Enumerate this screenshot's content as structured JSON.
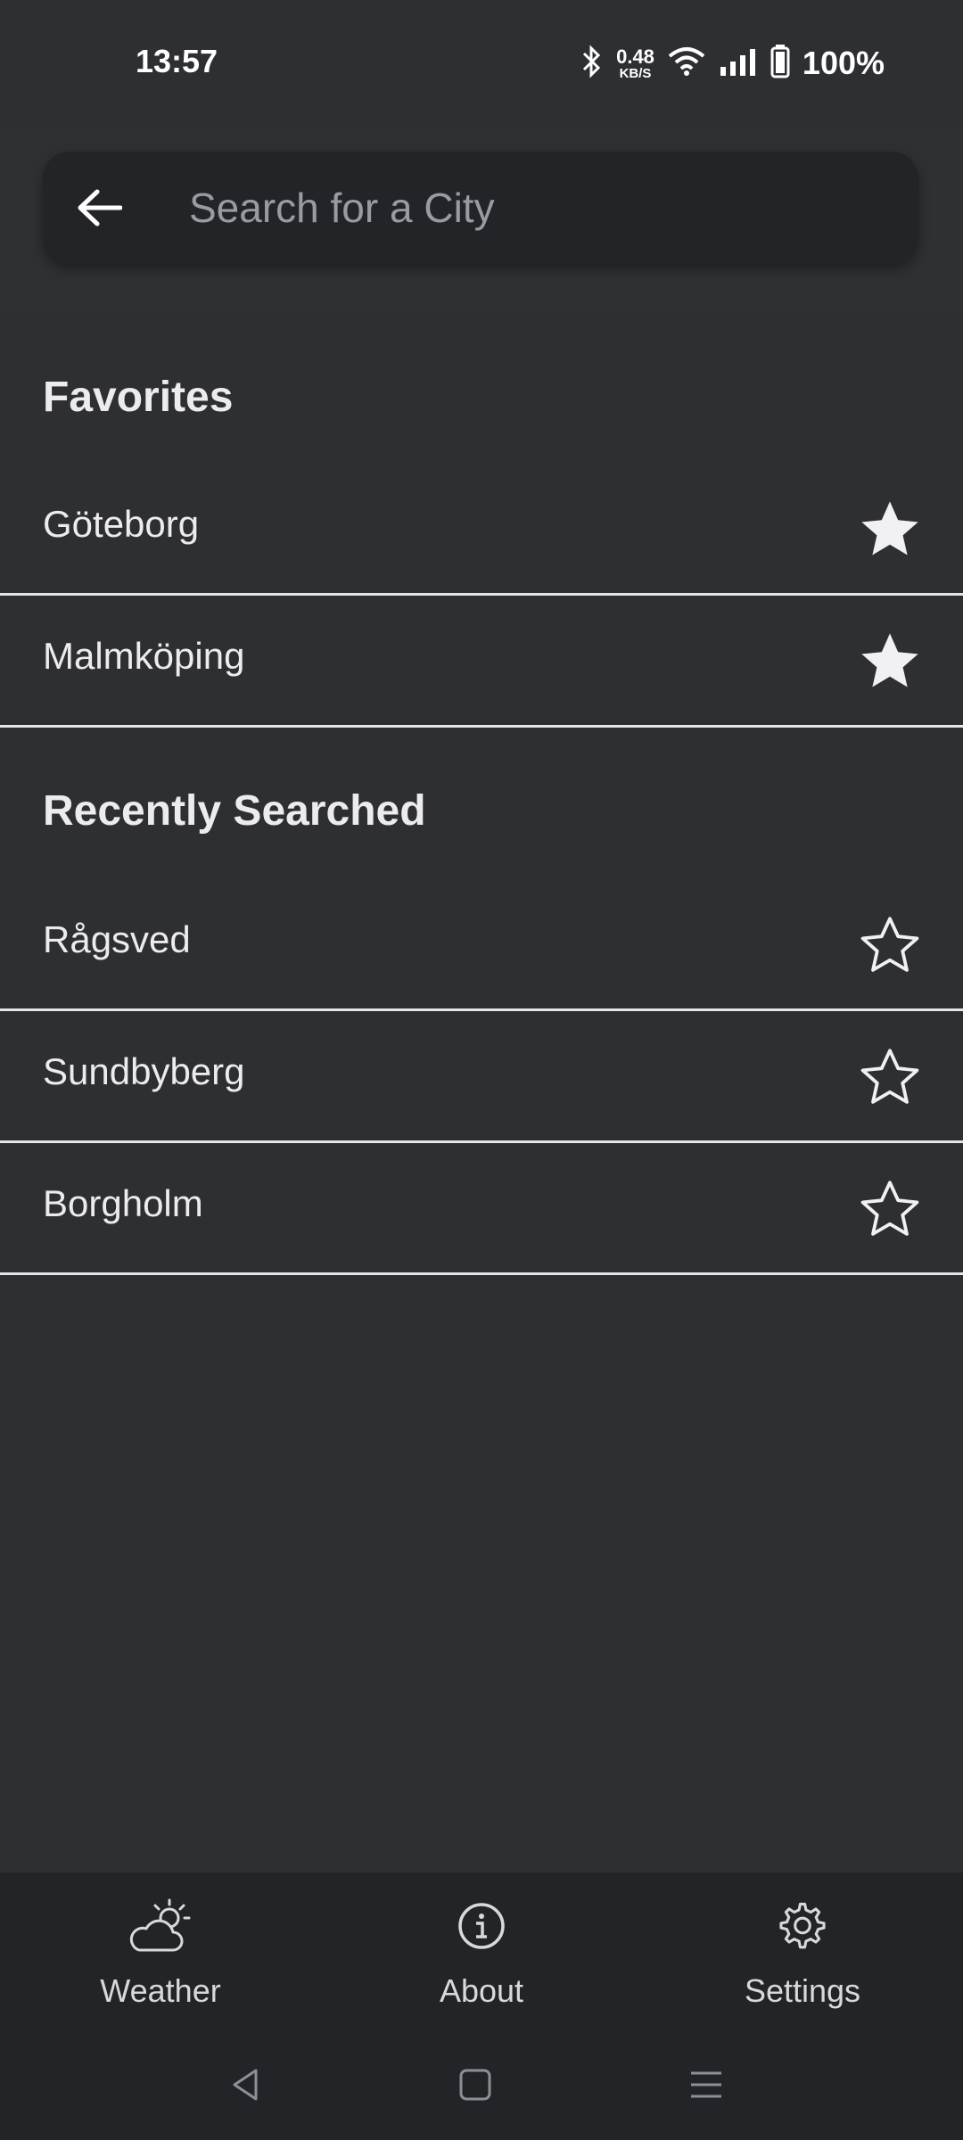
{
  "status_bar": {
    "time": "13:57",
    "net_speed_value": "0.48",
    "net_speed_unit": "KB/S",
    "battery": "100%",
    "icons": [
      "bluetooth-icon",
      "wifi-icon",
      "signal-icon",
      "battery-icon"
    ]
  },
  "search": {
    "placeholder": "Search for a City",
    "value": ""
  },
  "favorites": {
    "title": "Favorites",
    "items": [
      {
        "name": "Göteborg",
        "favorite": true
      },
      {
        "name": "Malmköping",
        "favorite": true
      }
    ]
  },
  "recent": {
    "title": "Recently Searched",
    "items": [
      {
        "name": "Rågsved",
        "favorite": false
      },
      {
        "name": "Sundbyberg",
        "favorite": false
      },
      {
        "name": "Borgholm",
        "favorite": false
      }
    ]
  },
  "bottom_nav": {
    "items": [
      {
        "label": "Weather",
        "icon": "weather-icon"
      },
      {
        "label": "About",
        "icon": "info-icon"
      },
      {
        "label": "Settings",
        "icon": "gear-icon"
      }
    ]
  },
  "colors": {
    "background": "#2e2f33",
    "surface": "#232428",
    "text": "#ececee",
    "placeholder": "#9a9ba0"
  }
}
